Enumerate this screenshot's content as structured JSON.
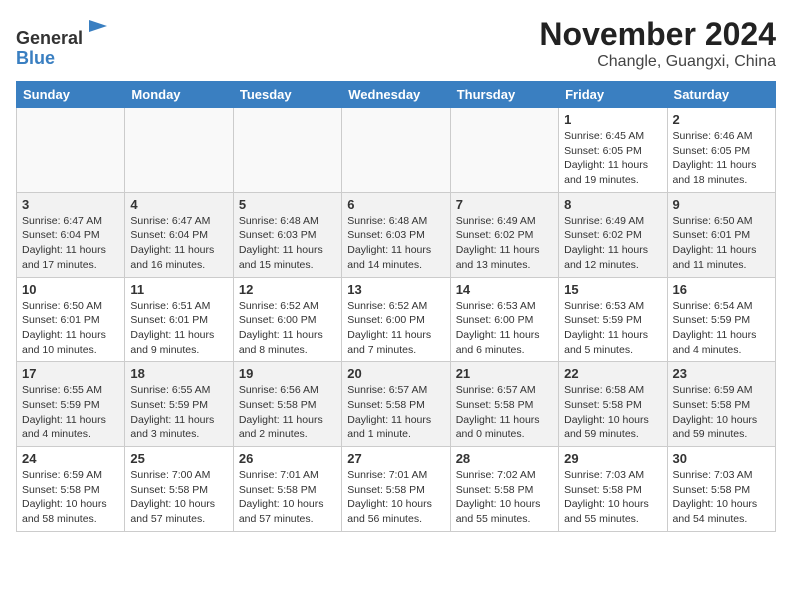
{
  "header": {
    "logo_line1": "General",
    "logo_line2": "Blue",
    "title": "November 2024",
    "subtitle": "Changle, Guangxi, China"
  },
  "weekdays": [
    "Sunday",
    "Monday",
    "Tuesday",
    "Wednesday",
    "Thursday",
    "Friday",
    "Saturday"
  ],
  "weeks": [
    [
      {
        "day": "",
        "empty": true
      },
      {
        "day": "",
        "empty": true
      },
      {
        "day": "",
        "empty": true
      },
      {
        "day": "",
        "empty": true
      },
      {
        "day": "",
        "empty": true
      },
      {
        "day": "1",
        "sunrise": "Sunrise: 6:45 AM",
        "sunset": "Sunset: 6:05 PM",
        "daylight": "Daylight: 11 hours and 19 minutes."
      },
      {
        "day": "2",
        "sunrise": "Sunrise: 6:46 AM",
        "sunset": "Sunset: 6:05 PM",
        "daylight": "Daylight: 11 hours and 18 minutes."
      }
    ],
    [
      {
        "day": "3",
        "sunrise": "Sunrise: 6:47 AM",
        "sunset": "Sunset: 6:04 PM",
        "daylight": "Daylight: 11 hours and 17 minutes."
      },
      {
        "day": "4",
        "sunrise": "Sunrise: 6:47 AM",
        "sunset": "Sunset: 6:04 PM",
        "daylight": "Daylight: 11 hours and 16 minutes."
      },
      {
        "day": "5",
        "sunrise": "Sunrise: 6:48 AM",
        "sunset": "Sunset: 6:03 PM",
        "daylight": "Daylight: 11 hours and 15 minutes."
      },
      {
        "day": "6",
        "sunrise": "Sunrise: 6:48 AM",
        "sunset": "Sunset: 6:03 PM",
        "daylight": "Daylight: 11 hours and 14 minutes."
      },
      {
        "day": "7",
        "sunrise": "Sunrise: 6:49 AM",
        "sunset": "Sunset: 6:02 PM",
        "daylight": "Daylight: 11 hours and 13 minutes."
      },
      {
        "day": "8",
        "sunrise": "Sunrise: 6:49 AM",
        "sunset": "Sunset: 6:02 PM",
        "daylight": "Daylight: 11 hours and 12 minutes."
      },
      {
        "day": "9",
        "sunrise": "Sunrise: 6:50 AM",
        "sunset": "Sunset: 6:01 PM",
        "daylight": "Daylight: 11 hours and 11 minutes."
      }
    ],
    [
      {
        "day": "10",
        "sunrise": "Sunrise: 6:50 AM",
        "sunset": "Sunset: 6:01 PM",
        "daylight": "Daylight: 11 hours and 10 minutes."
      },
      {
        "day": "11",
        "sunrise": "Sunrise: 6:51 AM",
        "sunset": "Sunset: 6:01 PM",
        "daylight": "Daylight: 11 hours and 9 minutes."
      },
      {
        "day": "12",
        "sunrise": "Sunrise: 6:52 AM",
        "sunset": "Sunset: 6:00 PM",
        "daylight": "Daylight: 11 hours and 8 minutes."
      },
      {
        "day": "13",
        "sunrise": "Sunrise: 6:52 AM",
        "sunset": "Sunset: 6:00 PM",
        "daylight": "Daylight: 11 hours and 7 minutes."
      },
      {
        "day": "14",
        "sunrise": "Sunrise: 6:53 AM",
        "sunset": "Sunset: 6:00 PM",
        "daylight": "Daylight: 11 hours and 6 minutes."
      },
      {
        "day": "15",
        "sunrise": "Sunrise: 6:53 AM",
        "sunset": "Sunset: 5:59 PM",
        "daylight": "Daylight: 11 hours and 5 minutes."
      },
      {
        "day": "16",
        "sunrise": "Sunrise: 6:54 AM",
        "sunset": "Sunset: 5:59 PM",
        "daylight": "Daylight: 11 hours and 4 minutes."
      }
    ],
    [
      {
        "day": "17",
        "sunrise": "Sunrise: 6:55 AM",
        "sunset": "Sunset: 5:59 PM",
        "daylight": "Daylight: 11 hours and 4 minutes."
      },
      {
        "day": "18",
        "sunrise": "Sunrise: 6:55 AM",
        "sunset": "Sunset: 5:59 PM",
        "daylight": "Daylight: 11 hours and 3 minutes."
      },
      {
        "day": "19",
        "sunrise": "Sunrise: 6:56 AM",
        "sunset": "Sunset: 5:58 PM",
        "daylight": "Daylight: 11 hours and 2 minutes."
      },
      {
        "day": "20",
        "sunrise": "Sunrise: 6:57 AM",
        "sunset": "Sunset: 5:58 PM",
        "daylight": "Daylight: 11 hours and 1 minute."
      },
      {
        "day": "21",
        "sunrise": "Sunrise: 6:57 AM",
        "sunset": "Sunset: 5:58 PM",
        "daylight": "Daylight: 11 hours and 0 minutes."
      },
      {
        "day": "22",
        "sunrise": "Sunrise: 6:58 AM",
        "sunset": "Sunset: 5:58 PM",
        "daylight": "Daylight: 10 hours and 59 minutes."
      },
      {
        "day": "23",
        "sunrise": "Sunrise: 6:59 AM",
        "sunset": "Sunset: 5:58 PM",
        "daylight": "Daylight: 10 hours and 59 minutes."
      }
    ],
    [
      {
        "day": "24",
        "sunrise": "Sunrise: 6:59 AM",
        "sunset": "Sunset: 5:58 PM",
        "daylight": "Daylight: 10 hours and 58 minutes."
      },
      {
        "day": "25",
        "sunrise": "Sunrise: 7:00 AM",
        "sunset": "Sunset: 5:58 PM",
        "daylight": "Daylight: 10 hours and 57 minutes."
      },
      {
        "day": "26",
        "sunrise": "Sunrise: 7:01 AM",
        "sunset": "Sunset: 5:58 PM",
        "daylight": "Daylight: 10 hours and 57 minutes."
      },
      {
        "day": "27",
        "sunrise": "Sunrise: 7:01 AM",
        "sunset": "Sunset: 5:58 PM",
        "daylight": "Daylight: 10 hours and 56 minutes."
      },
      {
        "day": "28",
        "sunrise": "Sunrise: 7:02 AM",
        "sunset": "Sunset: 5:58 PM",
        "daylight": "Daylight: 10 hours and 55 minutes."
      },
      {
        "day": "29",
        "sunrise": "Sunrise: 7:03 AM",
        "sunset": "Sunset: 5:58 PM",
        "daylight": "Daylight: 10 hours and 55 minutes."
      },
      {
        "day": "30",
        "sunrise": "Sunrise: 7:03 AM",
        "sunset": "Sunset: 5:58 PM",
        "daylight": "Daylight: 10 hours and 54 minutes."
      }
    ]
  ]
}
